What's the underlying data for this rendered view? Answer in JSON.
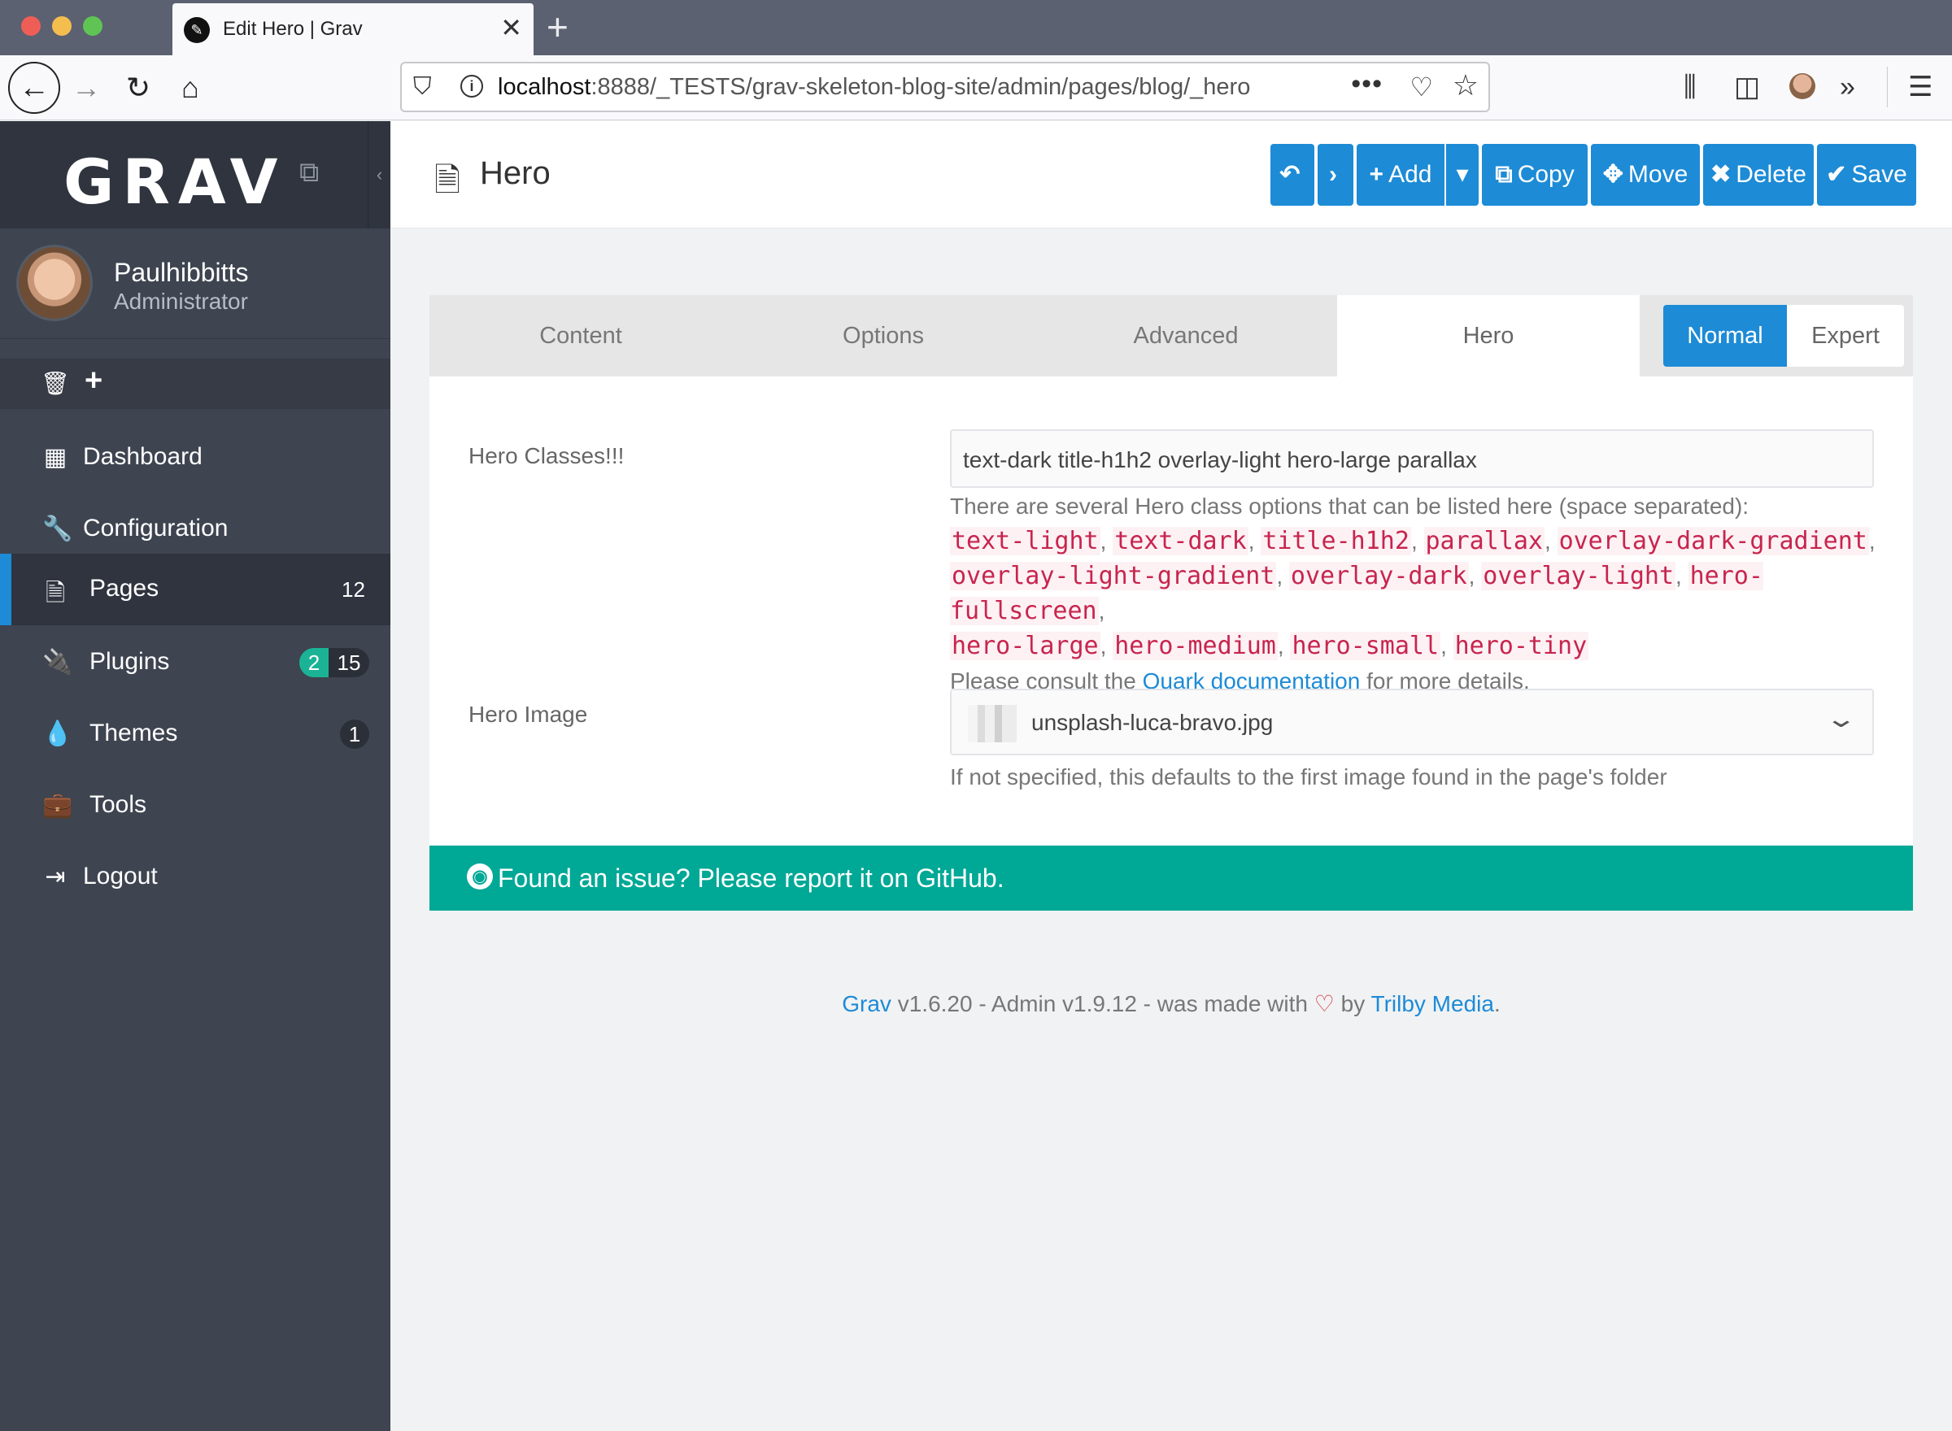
{
  "browser": {
    "tab_title": "Edit Hero | Grav",
    "tab_close": "✕",
    "new_tab": "+",
    "url_host": "localhost",
    "url_rest": ":8888/_TESTS/grav-skeleton-blog-site/admin/pages/blog/_hero",
    "url_more": "•••"
  },
  "sidebar": {
    "logo": "GRAV",
    "user": {
      "name": "Paulhibbitts",
      "role": "Administrator"
    },
    "items": [
      {
        "label": "Dashboard",
        "icon": "dashboard-icon",
        "glyph": "▦"
      },
      {
        "label": "Configuration",
        "icon": "wrench-icon",
        "glyph": "🔧"
      },
      {
        "label": "Pages",
        "icon": "file-icon",
        "glyph": "🗎",
        "badge": "12"
      },
      {
        "label": "Plugins",
        "icon": "plug-icon",
        "glyph": "🔌",
        "badge_update": "2",
        "badge": "15"
      },
      {
        "label": "Themes",
        "icon": "tint-icon",
        "glyph": "💧",
        "badge": "1"
      },
      {
        "label": "Tools",
        "icon": "briefcase-icon",
        "glyph": "💼"
      },
      {
        "label": "Logout",
        "icon": "sign-out-icon",
        "glyph": "⇥"
      }
    ]
  },
  "header": {
    "title": "Hero",
    "buttons": {
      "add": "Add",
      "copy": "Copy",
      "move": "Move",
      "delete": "Delete",
      "save": "Save"
    }
  },
  "form": {
    "tabs": [
      "Content",
      "Options",
      "Advanced",
      "Hero"
    ],
    "active_tab": "Hero",
    "modes": {
      "normal": "Normal",
      "expert": "Expert",
      "selected": "Normal"
    },
    "hero_classes": {
      "label": "Hero Classes!!!",
      "value": "text-dark title-h1h2 overlay-light hero-large parallax",
      "help_intro": "There are several Hero class options that can be listed here (space separated):",
      "options": [
        "text-light",
        "text-dark",
        "title-h1h2",
        "parallax",
        "overlay-dark-gradient",
        "overlay-light-gradient",
        "overlay-dark",
        "overlay-light",
        "hero-fullscreen",
        "hero-large",
        "hero-medium",
        "hero-small",
        "hero-tiny"
      ],
      "help_consult_pre": "Please consult the",
      "help_link": "Quark documentation",
      "help_consult_post": "for more details."
    },
    "hero_image": {
      "label": "Hero Image",
      "value": "unsplash-luca-bravo.jpg",
      "help": "If not specified, this defaults to the first image found in the page's folder"
    }
  },
  "issue_bar": {
    "text": "Found an issue? Please report it on GitHub."
  },
  "footer": {
    "grav_link": "Grav",
    "text_mid": "v1.6.20 - Admin v1.9.12 - was made with",
    "by": "by",
    "trilby_link": "Trilby Media",
    "end": "."
  },
  "colors": {
    "primary": "#1d8bd6",
    "sidebar": "#3e4450",
    "issue_bar": "#00a896",
    "badge_green": "#1bb395",
    "code_red": "#c7254e"
  }
}
